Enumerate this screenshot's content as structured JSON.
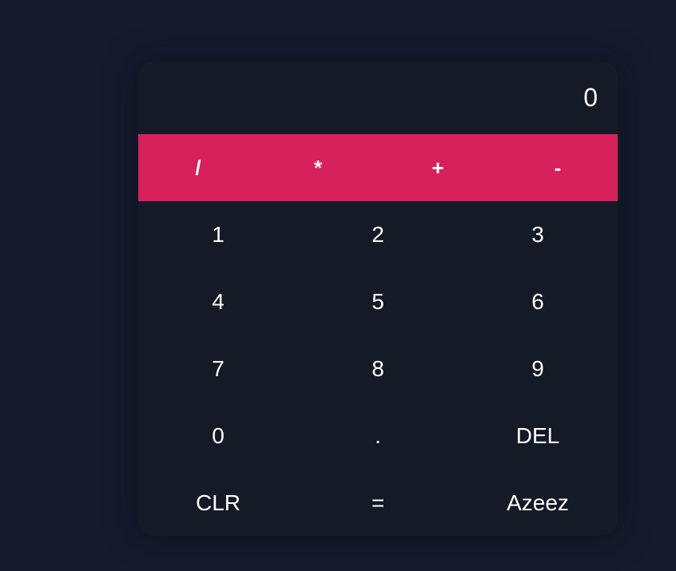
{
  "display": {
    "value": "0"
  },
  "operators": [
    {
      "name": "divide-button",
      "label": "/"
    },
    {
      "name": "multiply-button",
      "label": "*"
    },
    {
      "name": "add-button",
      "label": "+"
    },
    {
      "name": "subtract-button",
      "label": "-"
    }
  ],
  "keys": [
    {
      "name": "digit-1-button",
      "label": "1"
    },
    {
      "name": "digit-2-button",
      "label": "2"
    },
    {
      "name": "digit-3-button",
      "label": "3"
    },
    {
      "name": "digit-4-button",
      "label": "4"
    },
    {
      "name": "digit-5-button",
      "label": "5"
    },
    {
      "name": "digit-6-button",
      "label": "6"
    },
    {
      "name": "digit-7-button",
      "label": "7"
    },
    {
      "name": "digit-8-button",
      "label": "8"
    },
    {
      "name": "digit-9-button",
      "label": "9"
    },
    {
      "name": "digit-0-button",
      "label": "0"
    },
    {
      "name": "decimal-button",
      "label": "."
    },
    {
      "name": "delete-button",
      "label": "DEL"
    },
    {
      "name": "clear-button",
      "label": "CLR"
    },
    {
      "name": "equals-button",
      "label": "="
    },
    {
      "name": "azeez-button",
      "label": "Azeez"
    }
  ],
  "colors": {
    "background": "#141b2d",
    "panel": "#141a26",
    "accent": "#d6215c",
    "text": "#ffffff"
  }
}
